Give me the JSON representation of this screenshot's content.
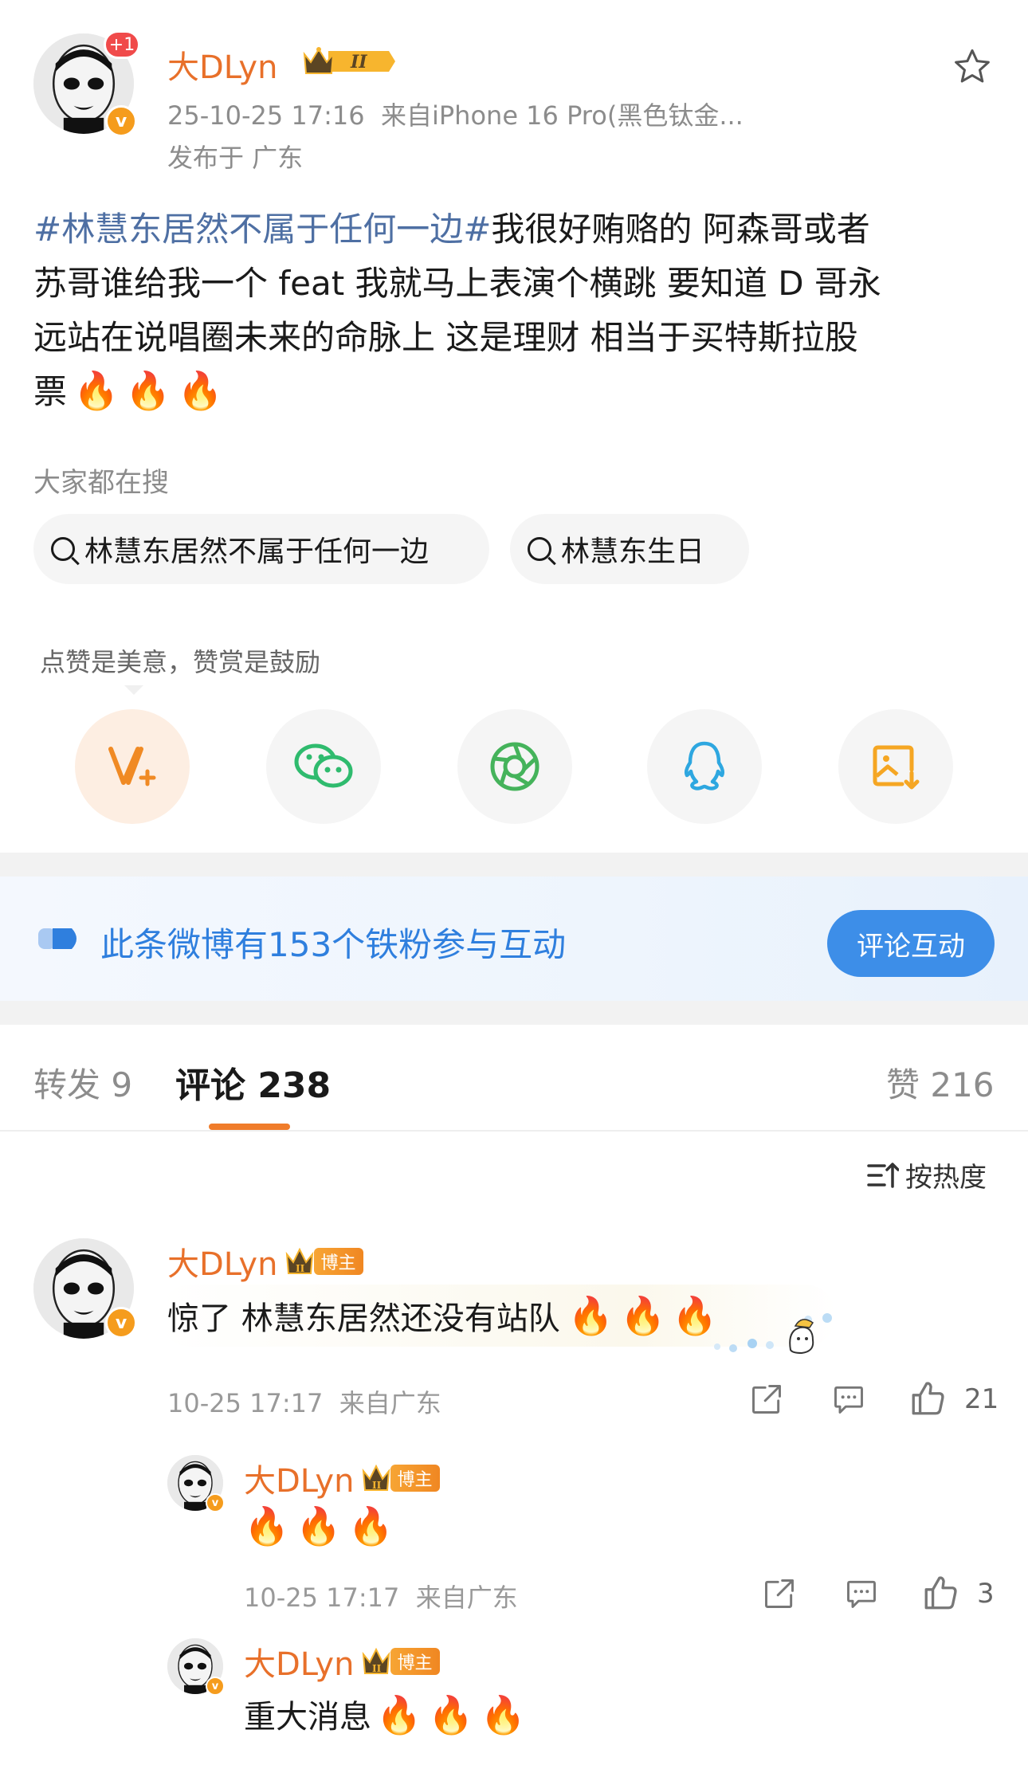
{
  "post": {
    "author": "大DLyn",
    "avatar_notice": "+1",
    "meta_line": "25-10-25 17:16  来自iPhone 16 Pro(黑色钛金...",
    "location": "发布于 广东",
    "hashtag": "#林慧东居然不属于任何一边#",
    "text_line1_rest": "我很好贿赂的 阿森哥或者",
    "text_line2": "苏哥谁给我一个 feat 我就马上表演个横跳 要知道 D 哥永",
    "text_line3": "远站在说唱圈未来的命脉上 这是理财 相当于买特斯拉股",
    "text_line4": "票",
    "fires": "🔥🔥🔥"
  },
  "search": {
    "title": "大家都在搜",
    "items": [
      "林慧东居然不属于任何一边",
      "林慧东生日"
    ]
  },
  "share": {
    "tip": "点赞是美意，赞赏是鼓励",
    "icons": [
      "reward-v-icon",
      "wechat-icon",
      "moments-icon",
      "qq-icon",
      "save-image-icon"
    ]
  },
  "fans_banner": {
    "text": "此条微博有153个铁粉参与互动",
    "button": "评论互动"
  },
  "tabs": {
    "repost": "转发 9",
    "comments": "评论 238",
    "likes": "赞 216"
  },
  "sort": {
    "label": "按热度"
  },
  "comments": [
    {
      "author": "大DLyn",
      "badge": "博主",
      "text": "惊了 林慧东居然还没有站队",
      "fires": "🔥🔥🔥",
      "time": "10-25 17:17  来自广东",
      "likes": "21"
    },
    {
      "author": "大DLyn",
      "badge": "博主",
      "text": "",
      "fires": "🔥🔥🔥",
      "time": "10-25 17:17  来自广东",
      "likes": "3"
    },
    {
      "author": "大DLyn",
      "badge": "博主",
      "text": "重大消息",
      "fires": "🔥🔥🔥"
    }
  ],
  "colors": {
    "accent_orange": "#e8702a",
    "link_blue": "#4e6fa3",
    "banner_blue": "#2f7fde",
    "tab_underline": "#f07c2a"
  }
}
